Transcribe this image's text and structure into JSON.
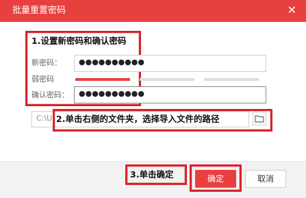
{
  "dialog": {
    "title": "批量重置密码",
    "close_symbol": "✕",
    "new_password_label": "新密码：",
    "new_password_value": "●●●●●●●●●●",
    "strength_label": "弱密码",
    "confirm_password_label": "确认密码：",
    "confirm_password_value": "●●●●●●●●●●",
    "file_path_value": "C:\\U",
    "ok_label": "确定",
    "cancel_label": "取消"
  },
  "annotations": {
    "step1": "1.设置新密码和确认密码",
    "step2": "2.单击右侧的文件夹，选择导入文件的路径",
    "step3": "3.单击确定"
  },
  "colors": {
    "accent": "#e8403f",
    "annotation": "#d8232a"
  }
}
